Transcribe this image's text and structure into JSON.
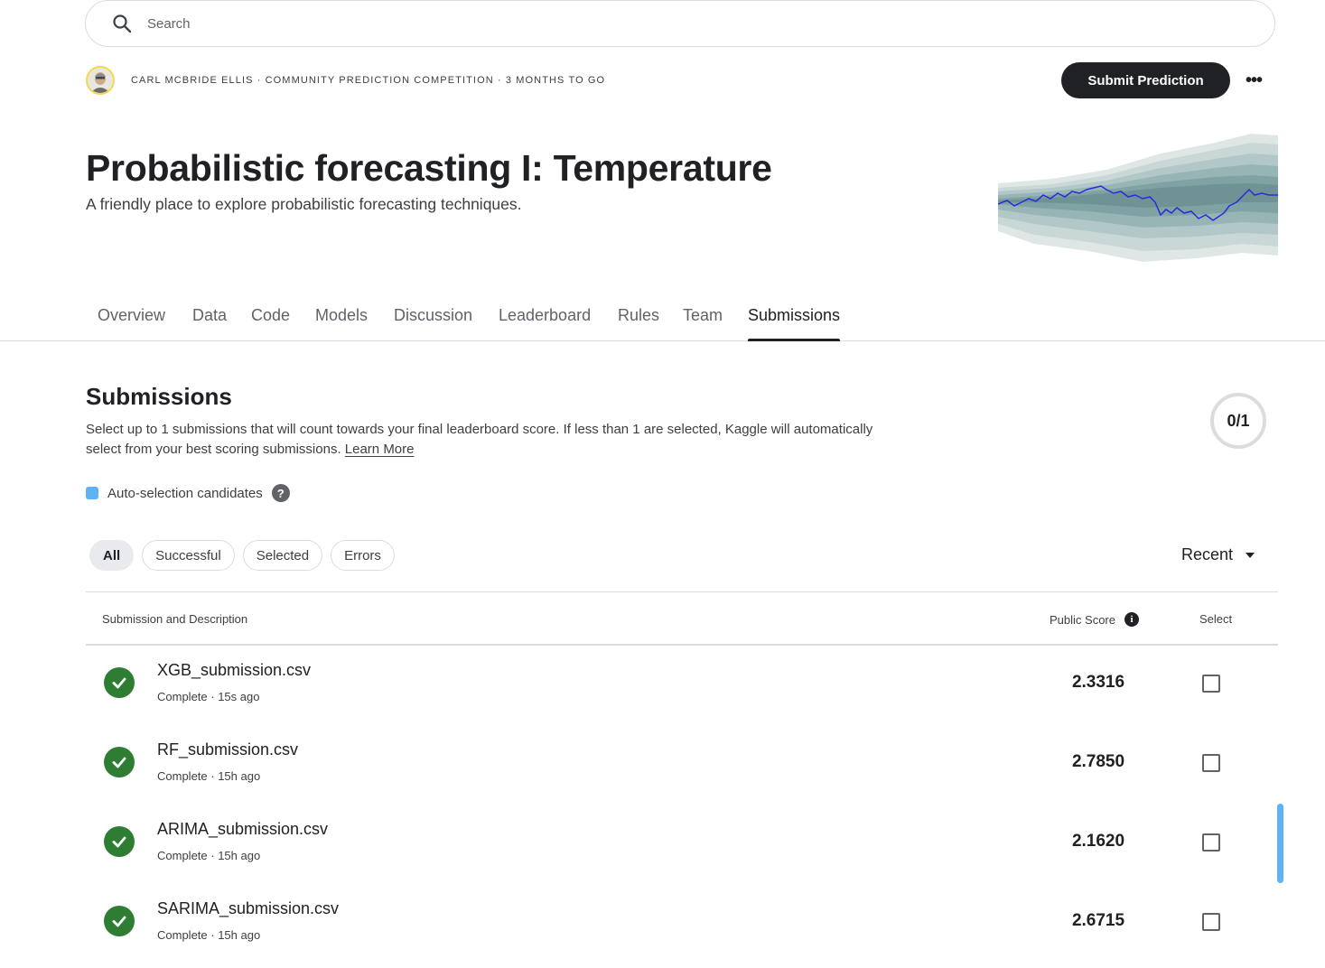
{
  "search": {
    "placeholder": "Search"
  },
  "header": {
    "meta": "CARL MCBRIDE ELLIS · COMMUNITY PREDICTION COMPETITION · 3 MONTHS TO GO",
    "submit_label": "Submit Prediction",
    "more_label": "•••"
  },
  "competition": {
    "title": "Probabilistic forecasting I: Temperature",
    "subtitle": "A friendly place to explore probabilistic forecasting techniques."
  },
  "tabs": [
    {
      "label": "Overview"
    },
    {
      "label": "Data"
    },
    {
      "label": "Code"
    },
    {
      "label": "Models"
    },
    {
      "label": "Discussion"
    },
    {
      "label": "Leaderboard"
    },
    {
      "label": "Rules"
    },
    {
      "label": "Team"
    },
    {
      "label": "Submissions"
    }
  ],
  "active_tab": "Submissions",
  "submissions_section": {
    "title": "Submissions",
    "description": "Select up to 1 submissions that will count towards your final leaderboard score. If less than 1 are selected, Kaggle will automatically select from your best scoring submissions.",
    "learn_more": "Learn More",
    "counter": "0/1",
    "legend_label": "Auto-selection candidates",
    "legend_help": "?"
  },
  "filters": [
    {
      "label": "All",
      "active": true
    },
    {
      "label": "Successful",
      "active": false
    },
    {
      "label": "Selected",
      "active": false
    },
    {
      "label": "Errors",
      "active": false
    }
  ],
  "sort": {
    "label": "Recent"
  },
  "table": {
    "headers": {
      "submission": "Submission and Description",
      "score": "Public Score",
      "score_info": "i",
      "select": "Select"
    },
    "rows": [
      {
        "name": "XGB_submission.csv",
        "status": "Complete · 15s ago",
        "score": "2.3316",
        "selected": false
      },
      {
        "name": "RF_submission.csv",
        "status": "Complete · 15h ago",
        "score": "2.7850",
        "selected": false
      },
      {
        "name": "ARIMA_submission.csv",
        "status": "Complete · 15h ago",
        "score": "2.1620",
        "selected": false
      },
      {
        "name": "SARIMA_submission.csv",
        "status": "Complete · 15h ago",
        "score": "2.6715",
        "selected": false
      }
    ]
  },
  "colors": {
    "primary_button": "#202124",
    "success_check": "#2e7d32",
    "auto_selection": "#5fb3f5",
    "banner_line": "#2b2bd9",
    "banner_fan": "#6f9a9c"
  }
}
